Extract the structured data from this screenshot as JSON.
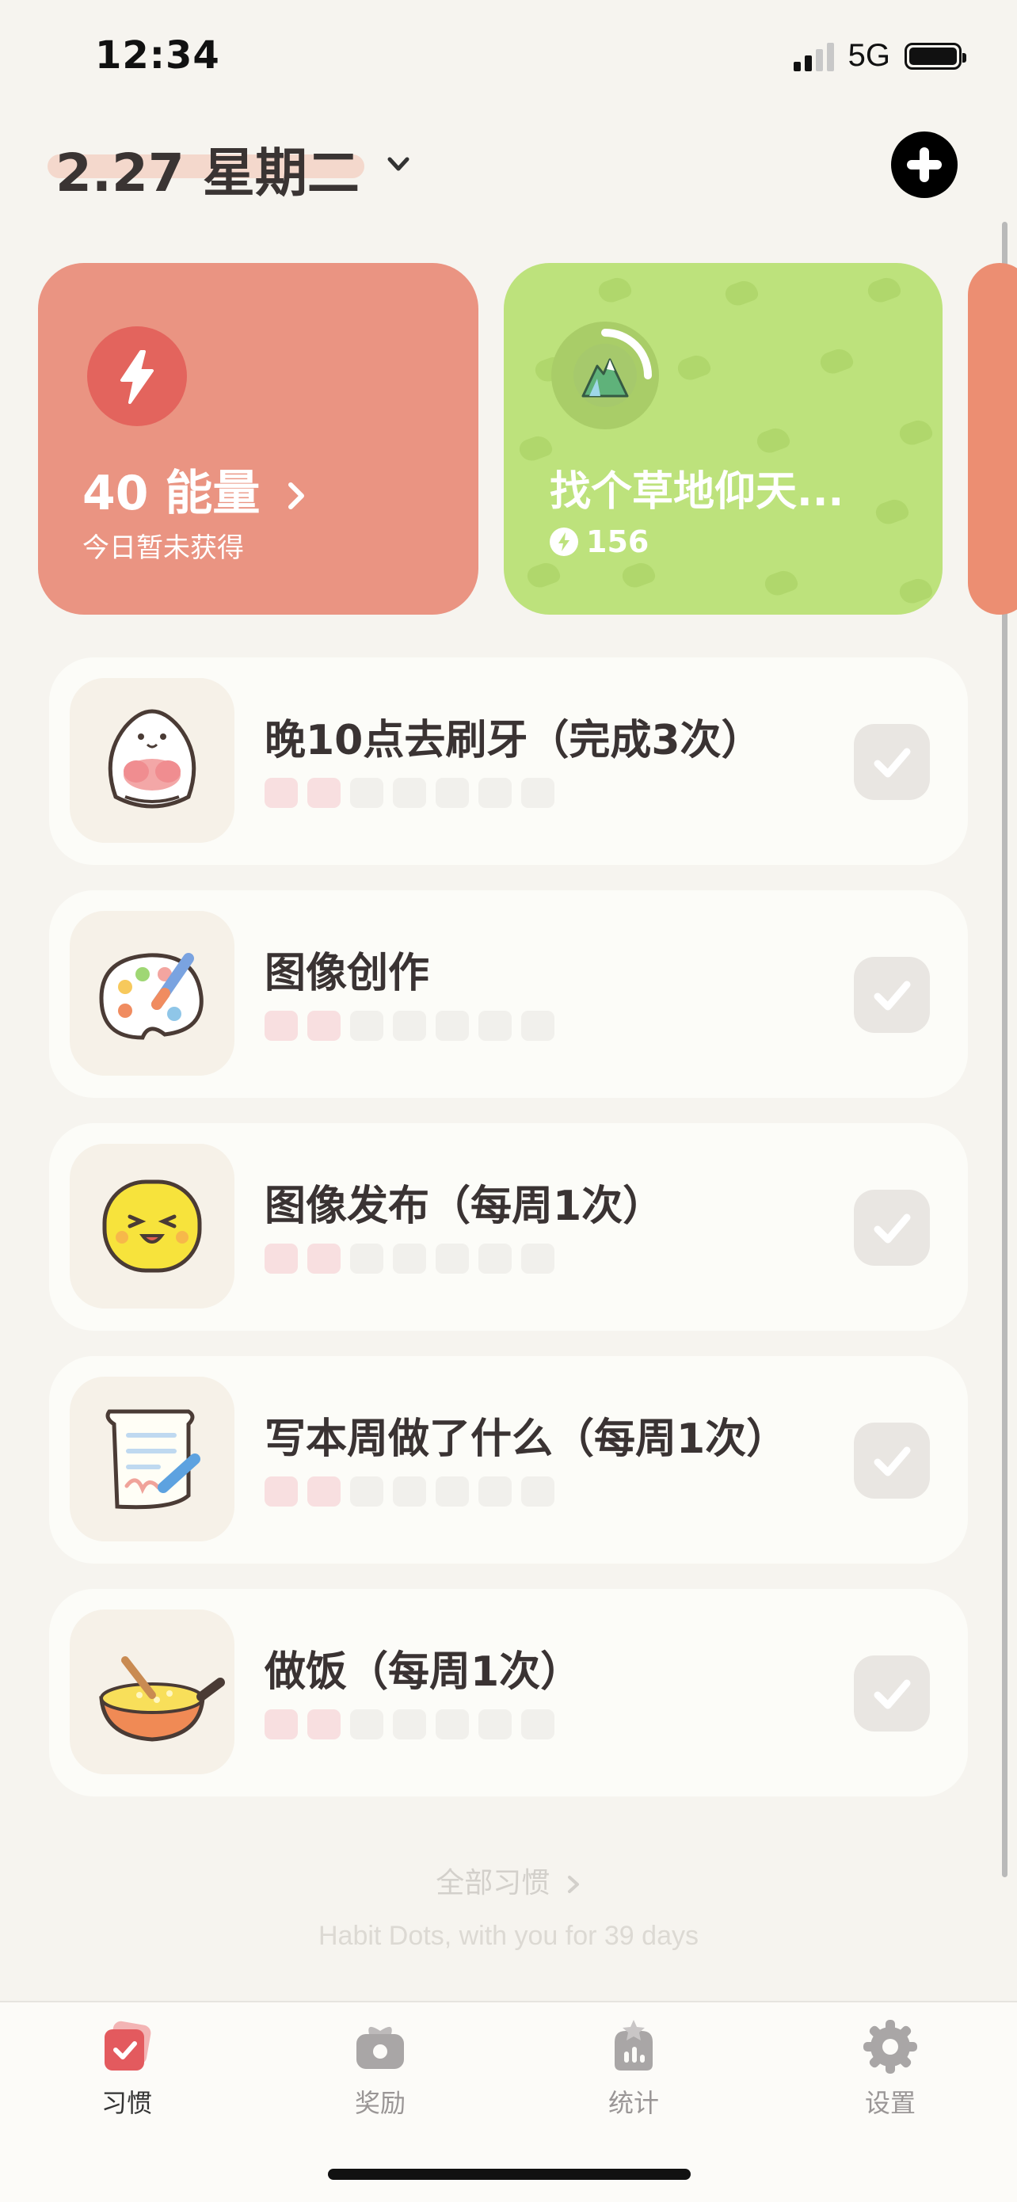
{
  "status_bar": {
    "time": "12:34",
    "network": "5G"
  },
  "header": {
    "date": "2.27 星期二"
  },
  "cards": {
    "energy": {
      "value_label": "40 能量",
      "subtitle": "今日暂未获得"
    },
    "reward": {
      "title": "找个草地仰天...",
      "cost": "156"
    }
  },
  "habits": [
    {
      "title": "晚10点去刷牙（完成3次）",
      "icon": "tooth-icon",
      "dots_filled": 2,
      "dots_total": 7
    },
    {
      "title": "图像创作",
      "icon": "paint-palette-icon",
      "dots_filled": 2,
      "dots_total": 7
    },
    {
      "title": "图像发布（每周1次）",
      "icon": "smiley-face-icon",
      "dots_filled": 2,
      "dots_total": 7
    },
    {
      "title": "写本周做了什么（每周1次）",
      "icon": "writing-paper-icon",
      "dots_filled": 2,
      "dots_total": 7
    },
    {
      "title": "做饭（每周1次）",
      "icon": "cooking-pan-icon",
      "dots_filled": 2,
      "dots_total": 7
    }
  ],
  "footer": {
    "all_habits": "全部习惯",
    "tagline": "Habit Dots, with you for 39 days"
  },
  "tabbar": {
    "habits": "习惯",
    "rewards": "奖励",
    "stats": "统计",
    "settings": "设置"
  },
  "colors": {
    "energy_card": "#ea9482",
    "reward_card": "#bde27c",
    "active_tab": "#e35a5e",
    "background": "#f6f4ef"
  }
}
